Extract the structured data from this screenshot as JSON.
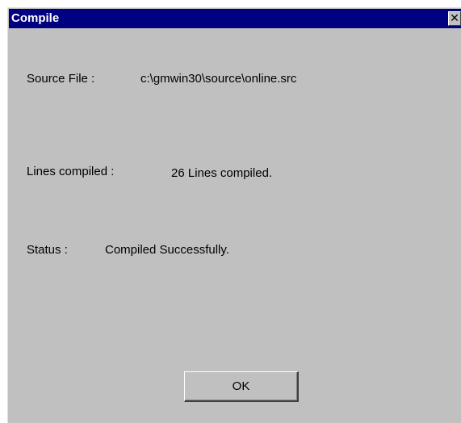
{
  "window": {
    "title": "Compile",
    "close_glyph": "✕",
    "close_icon": "close-icon"
  },
  "fields": {
    "source_file_label": "Source File :",
    "source_file_value": "c:\\gmwin30\\source\\online.src",
    "lines_compiled_label": "Lines compiled :",
    "lines_compiled_value": "26  Lines compiled.",
    "status_label": "Status :",
    "status_value": "Compiled Successfully."
  },
  "buttons": {
    "ok_label": "OK"
  },
  "colors": {
    "titlebar": "#000080",
    "window_bg": "#c0c0c0",
    "title_text": "#ffffff"
  }
}
